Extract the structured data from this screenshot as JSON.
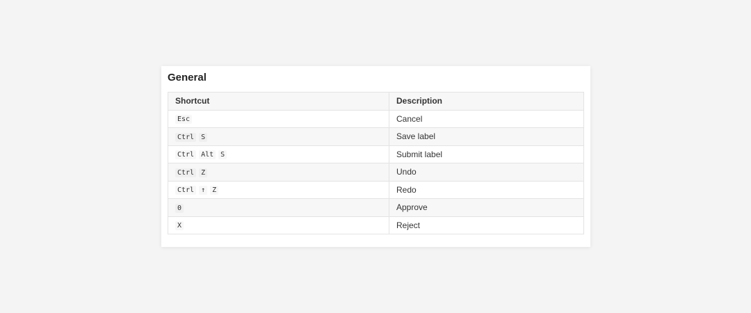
{
  "section": {
    "title": "General"
  },
  "table": {
    "headers": {
      "shortcut": "Shortcut",
      "description": "Description"
    },
    "rows": [
      {
        "keys": [
          "Esc"
        ],
        "description": "Cancel"
      },
      {
        "keys": [
          "Ctrl",
          "S"
        ],
        "description": "Save label"
      },
      {
        "keys": [
          "Ctrl",
          "Alt",
          "S"
        ],
        "description": "Submit label"
      },
      {
        "keys": [
          "Ctrl",
          "Z"
        ],
        "description": "Undo"
      },
      {
        "keys": [
          "Ctrl",
          "↑",
          "Z"
        ],
        "description": "Redo"
      },
      {
        "keys": [
          "0"
        ],
        "description": "Approve"
      },
      {
        "keys": [
          "X"
        ],
        "description": "Reject"
      }
    ]
  }
}
